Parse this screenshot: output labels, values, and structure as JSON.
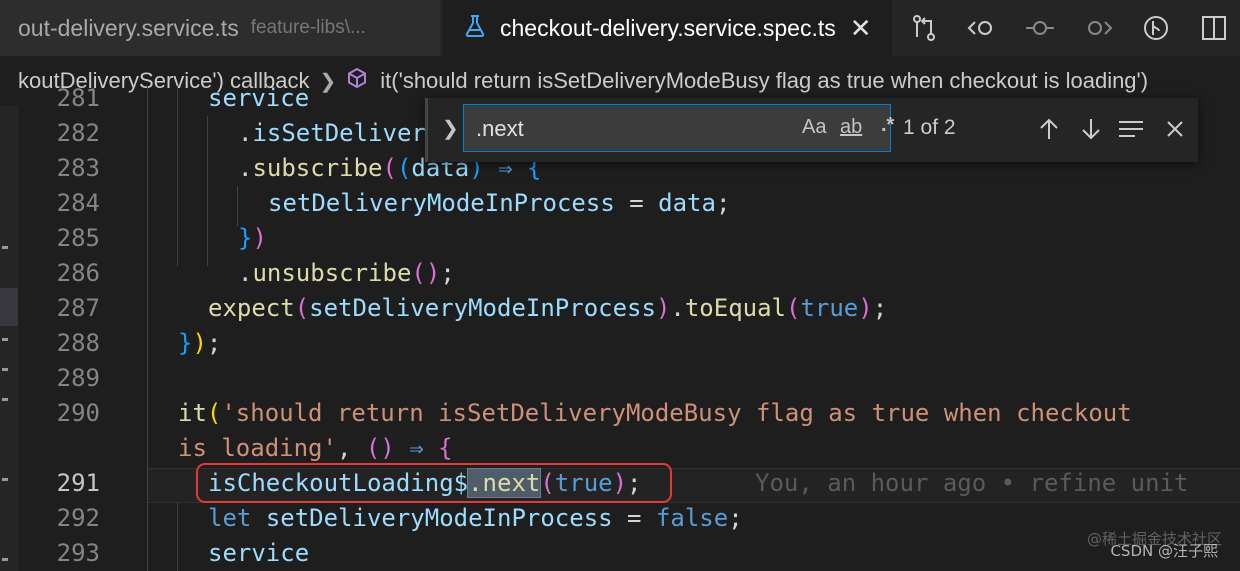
{
  "tabs": [
    {
      "name": "out-delivery.service.ts",
      "path": "feature-libs\\..."
    },
    {
      "name": "checkout-delivery.service.spec.ts",
      "close": "✕"
    }
  ],
  "breadcrumb": {
    "callback": "koutDeliveryService') callback",
    "symbol": "it('should return isSetDeliveryModeBusy flag as true when checkout is loading')"
  },
  "find": {
    "query": ".next",
    "match_case": "Aa",
    "whole_word": "ab",
    "regex": ".*",
    "result": "1 of 2"
  },
  "lines": [
    {
      "num": "281",
      "tokens": [
        [
          "var",
          "service"
        ]
      ]
    },
    {
      "num": "282",
      "tokens": [
        [
          "pun",
          "."
        ],
        [
          "var",
          "isSetDeliver"
        ]
      ]
    },
    {
      "num": "283",
      "tokens": [
        [
          "pun",
          "."
        ],
        [
          "fn",
          "subscribe"
        ],
        [
          "brP",
          "("
        ],
        [
          "brB",
          "("
        ],
        [
          "var",
          "data"
        ],
        [
          "brB",
          ")"
        ],
        [
          "pun",
          " "
        ],
        [
          "arrow",
          "⇒"
        ],
        [
          "pun",
          " "
        ],
        [
          "brB",
          "{"
        ]
      ]
    },
    {
      "num": "284",
      "tokens": [
        [
          "var",
          "setDeliveryModeInProcess"
        ],
        [
          "pun",
          " = "
        ],
        [
          "var",
          "data"
        ],
        [
          "pun",
          ";"
        ]
      ]
    },
    {
      "num": "285",
      "tokens": [
        [
          "brB",
          "}"
        ],
        [
          "brP",
          ")"
        ]
      ]
    },
    {
      "num": "286",
      "tokens": [
        [
          "pun",
          "."
        ],
        [
          "fn",
          "unsubscribe"
        ],
        [
          "brP",
          "()"
        ],
        [
          "pun",
          ";"
        ]
      ]
    },
    {
      "num": "287",
      "tokens": [
        [
          "fn",
          "expect"
        ],
        [
          "brP",
          "("
        ],
        [
          "var",
          "setDeliveryModeInProcess"
        ],
        [
          "brP",
          ")"
        ],
        [
          "pun",
          "."
        ],
        [
          "fn",
          "toEqual"
        ],
        [
          "brP",
          "("
        ],
        [
          "kw",
          "true"
        ],
        [
          "brP",
          ")"
        ],
        [
          "pun",
          ";"
        ]
      ]
    },
    {
      "num": "288",
      "tokens": [
        [
          "brB",
          "}"
        ],
        [
          "brY",
          ")"
        ],
        [
          "pun",
          ";"
        ]
      ]
    },
    {
      "num": "289",
      "tokens": []
    },
    {
      "num": "290",
      "tokens": [
        [
          "fn",
          "it"
        ],
        [
          "brY",
          "("
        ],
        [
          "str",
          "'should return isSetDeliveryModeBusy flag as true when checkout"
        ]
      ]
    },
    {
      "num": "",
      "tokens": [
        [
          "str",
          "is loading'"
        ],
        [
          "pun",
          ", "
        ],
        [
          "brP",
          "()"
        ],
        [
          "pun",
          " "
        ],
        [
          "arrow",
          "⇒"
        ],
        [
          "pun",
          " "
        ],
        [
          "brP",
          "{"
        ]
      ]
    },
    {
      "num": "291",
      "tokens": [
        [
          "var",
          "isCheckoutLoading$"
        ],
        [
          "fn",
          "_MATCH_"
        ],
        [
          "brP",
          "("
        ],
        [
          "kw",
          "true"
        ],
        [
          "brP",
          ")"
        ],
        [
          "pun",
          ";"
        ]
      ]
    },
    {
      "num": "292",
      "tokens": [
        [
          "kw",
          "let"
        ],
        [
          "pun",
          " "
        ],
        [
          "var",
          "setDeliveryModeInProcess"
        ],
        [
          "pun",
          " = "
        ],
        [
          "kw",
          "false"
        ],
        [
          "pun",
          ";"
        ]
      ]
    },
    {
      "num": "293",
      "tokens": [
        [
          "var",
          "service"
        ]
      ]
    }
  ],
  "match_text": ".next",
  "blame": "You, an hour ago • refine unit",
  "watermark": "CSDN @汪子熙",
  "watermark_site": "@稀土掘金技术社区",
  "colors": {
    "accent": "#007fd4",
    "highlight_box": "#e23a3a"
  }
}
